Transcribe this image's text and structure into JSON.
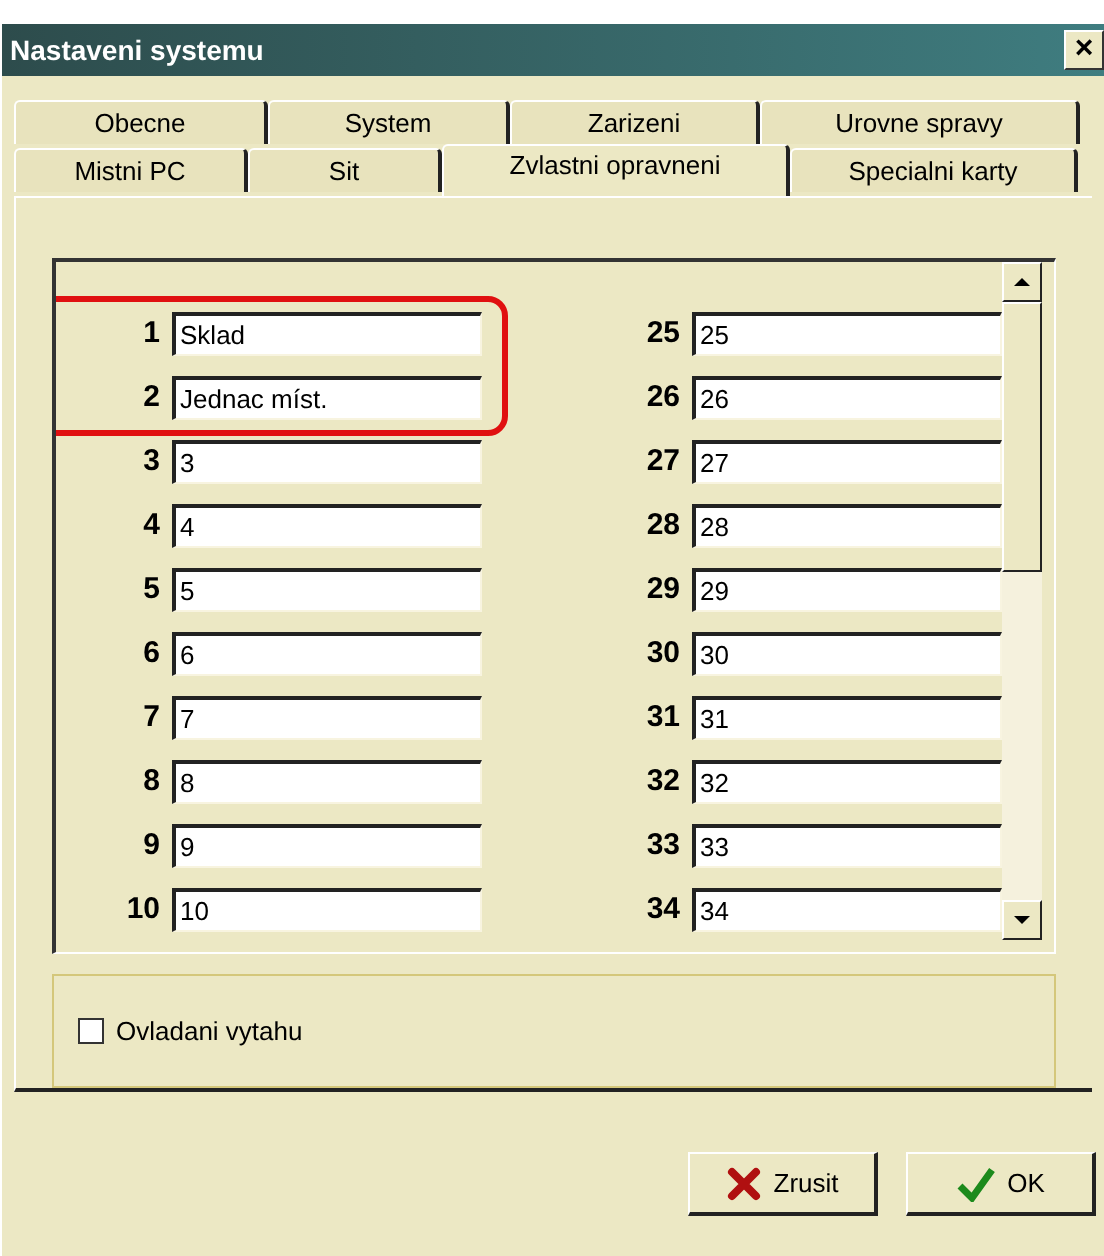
{
  "window": {
    "title": "Nastaveni systemu",
    "close": "×"
  },
  "tab_rows": [
    [
      {
        "label": "Obecne",
        "selected": false
      },
      {
        "label": "System",
        "selected": false
      },
      {
        "label": "Zarizeni",
        "selected": false
      },
      {
        "label": "Urovne spravy",
        "selected": false
      }
    ],
    [
      {
        "label": "Mistni PC",
        "selected": false
      },
      {
        "label": "Sit",
        "selected": false
      },
      {
        "label": "Zvlastni opravneni",
        "selected": true
      },
      {
        "label": "Specialni karty",
        "selected": false
      }
    ]
  ],
  "columns": [
    [
      {
        "number": "1",
        "value": "Sklad",
        "highlighted": true
      },
      {
        "number": "2",
        "value": "Jednac míst.",
        "highlighted": true
      },
      {
        "number": "3",
        "value": "3",
        "highlighted": false
      },
      {
        "number": "4",
        "value": "4",
        "highlighted": false
      },
      {
        "number": "5",
        "value": "5",
        "highlighted": false
      },
      {
        "number": "6",
        "value": "6",
        "highlighted": false
      },
      {
        "number": "7",
        "value": "7",
        "highlighted": false
      },
      {
        "number": "8",
        "value": "8",
        "highlighted": false
      },
      {
        "number": "9",
        "value": "9",
        "highlighted": false
      },
      {
        "number": "10",
        "value": "10",
        "highlighted": false
      }
    ],
    [
      {
        "number": "25",
        "value": "25",
        "highlighted": false
      },
      {
        "number": "26",
        "value": "26",
        "highlighted": false
      },
      {
        "number": "27",
        "value": "27",
        "highlighted": false
      },
      {
        "number": "28",
        "value": "28",
        "highlighted": false
      },
      {
        "number": "29",
        "value": "29",
        "highlighted": false
      },
      {
        "number": "30",
        "value": "30",
        "highlighted": false
      },
      {
        "number": "31",
        "value": "31",
        "highlighted": false
      },
      {
        "number": "32",
        "value": "32",
        "highlighted": false
      },
      {
        "number": "33",
        "value": "33",
        "highlighted": false
      },
      {
        "number": "34",
        "value": "34",
        "highlighted": false
      }
    ]
  ],
  "checkbox": {
    "label": "Ovladani vytahu",
    "checked": false
  },
  "buttons": [
    {
      "kind": "cancel",
      "label": "Zrusit"
    },
    {
      "kind": "ok",
      "label": "OK"
    }
  ]
}
